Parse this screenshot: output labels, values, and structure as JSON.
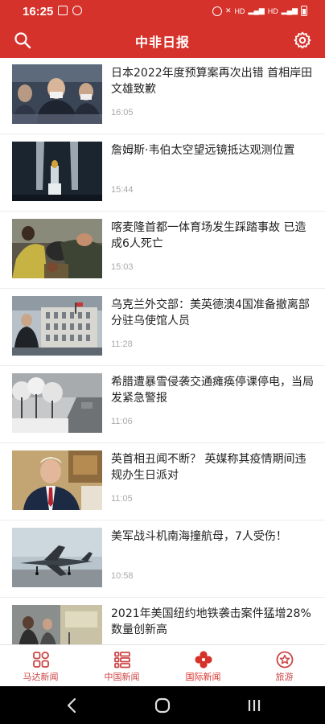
{
  "status": {
    "time": "16:25",
    "network_labels": [
      "HD",
      "HD"
    ]
  },
  "app": {
    "title": "中非日报",
    "search_icon": "search-icon",
    "settings_icon": "gear-icon"
  },
  "news": [
    {
      "title": "日本2022年度预算案再次出错 首相岸田文雄致歉",
      "time": "16:05",
      "image": "japan-pm-photo"
    },
    {
      "title": "詹姆斯·韦伯太空望远镜抵达观测位置",
      "time": "15:44",
      "image": "telescope-photo"
    },
    {
      "title": "喀麦隆首都一体育场发生踩踏事故 已造成6人死亡",
      "time": "15:03",
      "image": "stadium-photo"
    },
    {
      "title": "乌克兰外交部：美英德澳4国准备撤离部分驻乌使馆人员",
      "time": "11:28",
      "image": "embassy-photo"
    },
    {
      "title": "希腊遭暴雪侵袭交通瘫痪停课停电，当局发紧急警报",
      "time": "11:06",
      "image": "snow-photo"
    },
    {
      "title": "英首相丑闻不断？ 英媒称其疫情期间违规办生日派对",
      "time": "11:05",
      "image": "uk-pm-photo"
    },
    {
      "title": "美军战斗机南海撞航母，7人受伤！",
      "time": "10:58",
      "image": "fighter-jet-photo"
    },
    {
      "title": "2021年美国纽约地铁袭击案件猛增28% 数量创新高",
      "time": "",
      "image": "subway-photo"
    }
  ],
  "nav": [
    {
      "label": "马达新闻",
      "icon": "grid-icon"
    },
    {
      "label": "中国新闻",
      "icon": "list-icon"
    },
    {
      "label": "国际新闻",
      "icon": "clover-icon",
      "active": true
    },
    {
      "label": "旅游",
      "icon": "star-badge-icon"
    }
  ],
  "colors": {
    "brand": "#d6322c",
    "nav_inactive": "#c44444",
    "time_text": "#aaaaaa"
  }
}
